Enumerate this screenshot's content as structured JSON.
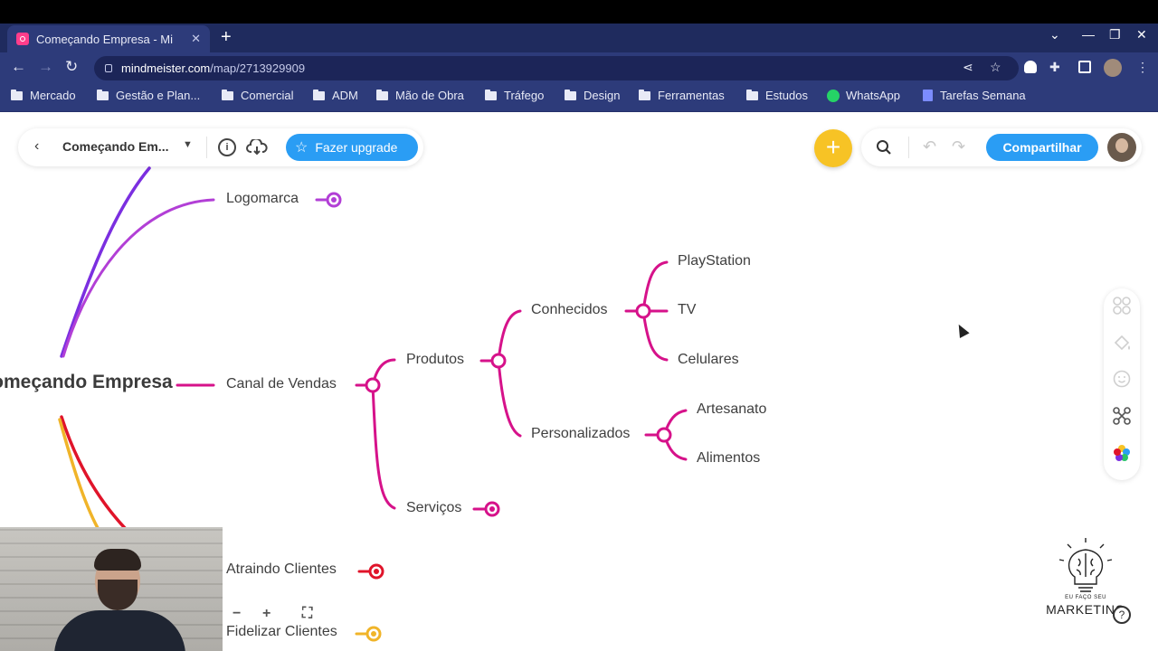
{
  "browser": {
    "tab_title": "Começando Empresa - Mi",
    "tab_close": "✕",
    "new_tab": "+",
    "url_host": "mindmeister.com",
    "url_path": "/map/2713929909",
    "window_controls": [
      "⌄",
      "—",
      "❐",
      "✕"
    ]
  },
  "bookmarks": [
    {
      "label": "Mercado",
      "icon": "folder-icon"
    },
    {
      "label": "Gestão e Plan...",
      "icon": "folder-icon"
    },
    {
      "label": "Comercial",
      "icon": "folder-icon"
    },
    {
      "label": "ADM",
      "icon": "folder-icon"
    },
    {
      "label": "Mão de Obra",
      "icon": "folder-icon"
    },
    {
      "label": "Tráfego",
      "icon": "folder-icon"
    },
    {
      "label": "Design",
      "icon": "folder-icon"
    },
    {
      "label": "Ferramentas",
      "icon": "folder-icon"
    },
    {
      "label": "Estudos",
      "icon": "folder-icon"
    },
    {
      "label": "WhatsApp",
      "icon": "whatsapp-icon"
    },
    {
      "label": "Tarefas Semana",
      "icon": "tasks-icon"
    }
  ],
  "app": {
    "map_name": "Começando Em...",
    "upgrade_label": "Fazer upgrade",
    "share_label": "Compartilhar",
    "info_glyph": "i",
    "add_glyph": "+"
  },
  "mindmap": {
    "root": "Começando Empresa",
    "nodes": {
      "logomarca": "Logomarca",
      "canal": "Canal de Vendas",
      "produtos": "Produtos",
      "servicos": "Serviços",
      "conhecidos": "Conhecidos",
      "personalizados": "Personalizados",
      "playstation": "PlayStation",
      "tv": "TV",
      "celulares": "Celulares",
      "artesanato": "Artesanato",
      "alimentos": "Alimentos",
      "atraindo": "Atraindo Clientes",
      "fidelizar": "Fidelizar Clientes"
    },
    "colors": {
      "purple": "#7b2fe0",
      "violet": "#b23fd6",
      "magenta": "#d6128a",
      "red": "#e0142a",
      "yellow": "#f0b429"
    }
  },
  "zoom_controls": [
    "−",
    "+",
    "⛶"
  ],
  "watermark": {
    "line1": "EU FAÇO SEU",
    "line2": "MARKETING"
  },
  "help_glyph": "?"
}
